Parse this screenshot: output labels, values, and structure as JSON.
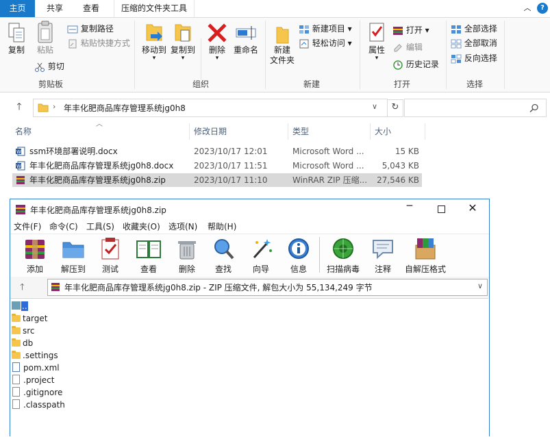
{
  "ribbon_tabs": {
    "file": "主页",
    "share": "共享",
    "view": "查看",
    "tools": "压缩的文件夹工具"
  },
  "clipboard": {
    "group_label": "剪贴板",
    "copy": "复制",
    "paste": "粘贴",
    "copy_path": "复制路径",
    "paste_shortcut": "粘贴快捷方式",
    "cut": "剪切"
  },
  "organize": {
    "group_label": "组织",
    "move_to": "移动到",
    "copy_to": "复制到",
    "delete": "删除",
    "rename": "重命名"
  },
  "new": {
    "group_label": "新建",
    "new_folder_line1": "新建",
    "new_folder_line2": "文件夹",
    "new_item": "新建项目 ▾",
    "easy_access": "轻松访问 ▾"
  },
  "open": {
    "group_label": "打开",
    "properties": "属性",
    "open": "打开 ▾",
    "edit": "编辑",
    "history": "历史记录"
  },
  "select": {
    "group_label": "选择",
    "select_all": "全部选择",
    "select_none": "全部取消",
    "invert": "反向选择"
  },
  "address": {
    "path": "年丰化肥商品库存管理系统jg0h8"
  },
  "columns": {
    "name": "名称",
    "date": "修改日期",
    "type": "类型",
    "size": "大小"
  },
  "files": [
    {
      "name": "ssm环境部署说明.docx",
      "date": "2023/10/17 12:01",
      "type": "Microsoft Word ...",
      "size": "15 KB",
      "icon": "word-icon"
    },
    {
      "name": "年丰化肥商品库存管理系统jg0h8.docx",
      "date": "2023/10/17 11:51",
      "type": "Microsoft Word ...",
      "size": "5,043 KB",
      "icon": "word-icon"
    },
    {
      "name": "年丰化肥商品库存管理系统jg0h8.zip",
      "date": "2023/10/17 11:10",
      "type": "WinRAR ZIP 压缩...",
      "size": "27,546 KB",
      "icon": "winrar-icon"
    }
  ],
  "rar": {
    "title": "年丰化肥商品库存管理系统jg0h8.zip",
    "menu": [
      "文件(F)",
      "命令(C)",
      "工具(S)",
      "收藏夹(O)",
      "选项(N)",
      "帮助(H)"
    ],
    "toolbar": [
      "添加",
      "解压到",
      "测试",
      "查看",
      "删除",
      "查找",
      "向导",
      "信息",
      "扫描病毒",
      "注释",
      "自解压格式"
    ],
    "path": "年丰化肥商品库存管理系统jg0h8.zip - ZIP 压缩文件, 解包大小为 55,134,249 字节",
    "items": [
      {
        "name": "..",
        "kind": "up"
      },
      {
        "name": "target",
        "kind": "folder"
      },
      {
        "name": "src",
        "kind": "folder"
      },
      {
        "name": "db",
        "kind": "folder"
      },
      {
        "name": ".settings",
        "kind": "folder"
      },
      {
        "name": "pom.xml",
        "kind": "xml"
      },
      {
        "name": ".project",
        "kind": "file"
      },
      {
        "name": ".gitignore",
        "kind": "file"
      },
      {
        "name": ".classpath",
        "kind": "file"
      }
    ]
  },
  "colors": {
    "accent": "#1979ca",
    "selection": "#d9d9d9",
    "folder": "#f5c64b",
    "rar_border": "#2f7fd0"
  }
}
